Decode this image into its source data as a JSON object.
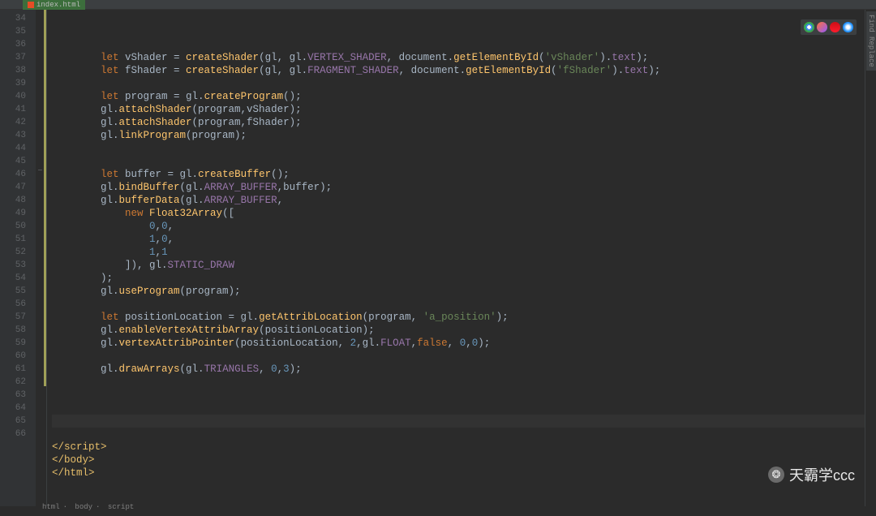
{
  "tab": {
    "filename": "index.html"
  },
  "gutter": {
    "start": 34,
    "end": 66
  },
  "code": {
    "lines": [
      {
        "n": 34,
        "indent": 2,
        "tokens": [
          [
            "kw",
            "let"
          ],
          [
            "plain",
            " vShader = "
          ],
          [
            "fn",
            "createShader"
          ],
          [
            "plain",
            "(gl, gl."
          ],
          [
            "ident",
            "VERTEX_SHADER"
          ],
          [
            "plain",
            ", document."
          ],
          [
            "fn",
            "getElementById"
          ],
          [
            "plain",
            "("
          ],
          [
            "str",
            "'vShader'"
          ],
          [
            "plain",
            ")."
          ],
          [
            "ident",
            "text"
          ],
          [
            "plain",
            ");"
          ]
        ]
      },
      {
        "n": 35,
        "indent": 2,
        "tokens": [
          [
            "kw",
            "let"
          ],
          [
            "plain",
            " fShader = "
          ],
          [
            "fn",
            "createShader"
          ],
          [
            "plain",
            "(gl, gl."
          ],
          [
            "ident",
            "FRAGMENT_SHADER"
          ],
          [
            "plain",
            ", document."
          ],
          [
            "fn",
            "getElementById"
          ],
          [
            "plain",
            "("
          ],
          [
            "str",
            "'fShader'"
          ],
          [
            "plain",
            ")."
          ],
          [
            "ident",
            "text"
          ],
          [
            "plain",
            ");"
          ]
        ]
      },
      {
        "n": 36,
        "indent": 0,
        "tokens": []
      },
      {
        "n": 37,
        "indent": 2,
        "tokens": [
          [
            "kw",
            "let"
          ],
          [
            "plain",
            " program = gl."
          ],
          [
            "fn",
            "createProgram"
          ],
          [
            "plain",
            "();"
          ]
        ]
      },
      {
        "n": 38,
        "indent": 2,
        "tokens": [
          [
            "plain",
            "gl."
          ],
          [
            "fn",
            "attachShader"
          ],
          [
            "plain",
            "(program,vShader);"
          ]
        ]
      },
      {
        "n": 39,
        "indent": 2,
        "tokens": [
          [
            "plain",
            "gl."
          ],
          [
            "fn",
            "attachShader"
          ],
          [
            "plain",
            "(program,fShader);"
          ]
        ]
      },
      {
        "n": 40,
        "indent": 2,
        "tokens": [
          [
            "plain",
            "gl."
          ],
          [
            "fn",
            "linkProgram"
          ],
          [
            "plain",
            "(program);"
          ]
        ]
      },
      {
        "n": 41,
        "indent": 0,
        "tokens": []
      },
      {
        "n": 42,
        "indent": 0,
        "tokens": []
      },
      {
        "n": 43,
        "indent": 2,
        "tokens": [
          [
            "kw",
            "let"
          ],
          [
            "plain",
            " buffer = gl."
          ],
          [
            "fn",
            "createBuffer"
          ],
          [
            "plain",
            "();"
          ]
        ]
      },
      {
        "n": 44,
        "indent": 2,
        "tokens": [
          [
            "plain",
            "gl."
          ],
          [
            "fn",
            "bindBuffer"
          ],
          [
            "plain",
            "(gl."
          ],
          [
            "ident",
            "ARRAY_BUFFER"
          ],
          [
            "plain",
            ",buffer);"
          ]
        ]
      },
      {
        "n": 45,
        "indent": 2,
        "tokens": [
          [
            "plain",
            "gl."
          ],
          [
            "fn",
            "bufferData"
          ],
          [
            "plain",
            "(gl."
          ],
          [
            "ident",
            "ARRAY_BUFFER"
          ],
          [
            "plain",
            ","
          ]
        ]
      },
      {
        "n": 46,
        "indent": 3,
        "tokens": [
          [
            "kw",
            "new"
          ],
          [
            "plain",
            " "
          ],
          [
            "fn",
            "Float32Array"
          ],
          [
            "plain",
            "(["
          ]
        ]
      },
      {
        "n": 47,
        "indent": 4,
        "tokens": [
          [
            "num",
            "0"
          ],
          [
            "plain",
            ","
          ],
          [
            "num",
            "0"
          ],
          [
            "plain",
            ","
          ]
        ]
      },
      {
        "n": 48,
        "indent": 4,
        "tokens": [
          [
            "num",
            "1"
          ],
          [
            "plain",
            ","
          ],
          [
            "num",
            "0"
          ],
          [
            "plain",
            ","
          ]
        ]
      },
      {
        "n": 49,
        "indent": 4,
        "tokens": [
          [
            "num",
            "1"
          ],
          [
            "plain",
            ","
          ],
          [
            "num",
            "1"
          ]
        ]
      },
      {
        "n": 50,
        "indent": 3,
        "tokens": [
          [
            "plain",
            "]), gl."
          ],
          [
            "ident",
            "STATIC_DRAW"
          ]
        ]
      },
      {
        "n": 51,
        "indent": 2,
        "tokens": [
          [
            "plain",
            ");"
          ]
        ]
      },
      {
        "n": 52,
        "indent": 2,
        "tokens": [
          [
            "plain",
            "gl."
          ],
          [
            "fn",
            "useProgram"
          ],
          [
            "plain",
            "(program);"
          ]
        ]
      },
      {
        "n": 53,
        "indent": 0,
        "tokens": []
      },
      {
        "n": 54,
        "indent": 2,
        "tokens": [
          [
            "kw",
            "let"
          ],
          [
            "plain",
            " positionLocation = gl."
          ],
          [
            "fn",
            "getAttribLocation"
          ],
          [
            "plain",
            "(program, "
          ],
          [
            "str",
            "'a_position'"
          ],
          [
            "plain",
            ");"
          ]
        ]
      },
      {
        "n": 55,
        "indent": 2,
        "tokens": [
          [
            "plain",
            "gl."
          ],
          [
            "fn",
            "enableVertexAttribArray"
          ],
          [
            "plain",
            "(positionLocation);"
          ]
        ]
      },
      {
        "n": 56,
        "indent": 2,
        "tokens": [
          [
            "plain",
            "gl."
          ],
          [
            "fn",
            "vertexAttribPointer"
          ],
          [
            "plain",
            "(positionLocation, "
          ],
          [
            "num",
            "2"
          ],
          [
            "plain",
            ",gl."
          ],
          [
            "ident",
            "FLOAT"
          ],
          [
            "plain",
            ","
          ],
          [
            "bool",
            "false"
          ],
          [
            "plain",
            ", "
          ],
          [
            "num",
            "0"
          ],
          [
            "plain",
            ","
          ],
          [
            "num",
            "0"
          ],
          [
            "plain",
            ");"
          ]
        ]
      },
      {
        "n": 57,
        "indent": 0,
        "tokens": []
      },
      {
        "n": 58,
        "indent": 2,
        "tokens": [
          [
            "plain",
            "gl."
          ],
          [
            "fn",
            "drawArrays"
          ],
          [
            "plain",
            "(gl."
          ],
          [
            "ident",
            "TRIANGLES"
          ],
          [
            "plain",
            ", "
          ],
          [
            "num",
            "0"
          ],
          [
            "plain",
            ","
          ],
          [
            "num",
            "3"
          ],
          [
            "plain",
            ");"
          ]
        ]
      },
      {
        "n": 59,
        "indent": 0,
        "tokens": []
      },
      {
        "n": 60,
        "indent": 0,
        "tokens": []
      },
      {
        "n": 61,
        "indent": 0,
        "tokens": []
      },
      {
        "n": 62,
        "indent": 0,
        "tokens": [],
        "current": true
      },
      {
        "n": 63,
        "indent": 0,
        "tokens": []
      },
      {
        "n": 64,
        "indent": 0,
        "tokens": [
          [
            "tag",
            "</script​>"
          ]
        ]
      },
      {
        "n": 65,
        "indent": 0,
        "tokens": [
          [
            "tag",
            "</body>"
          ]
        ]
      },
      {
        "n": 66,
        "indent": 0,
        "tokens": [
          [
            "tag",
            "</html>"
          ]
        ]
      }
    ]
  },
  "breadcrumbs": [
    "html",
    "body",
    "script"
  ],
  "sidebar": {
    "label": "Find Replace"
  },
  "browsers": [
    {
      "name": "chrome",
      "color": "#4285f4"
    },
    {
      "name": "firefox",
      "color": "#ff7139"
    },
    {
      "name": "opera",
      "color": "#cc0f16"
    },
    {
      "name": "safari",
      "color": "#1e90ff"
    }
  ],
  "watermark": {
    "text": "天霸学ccc",
    "icon": "❂"
  }
}
